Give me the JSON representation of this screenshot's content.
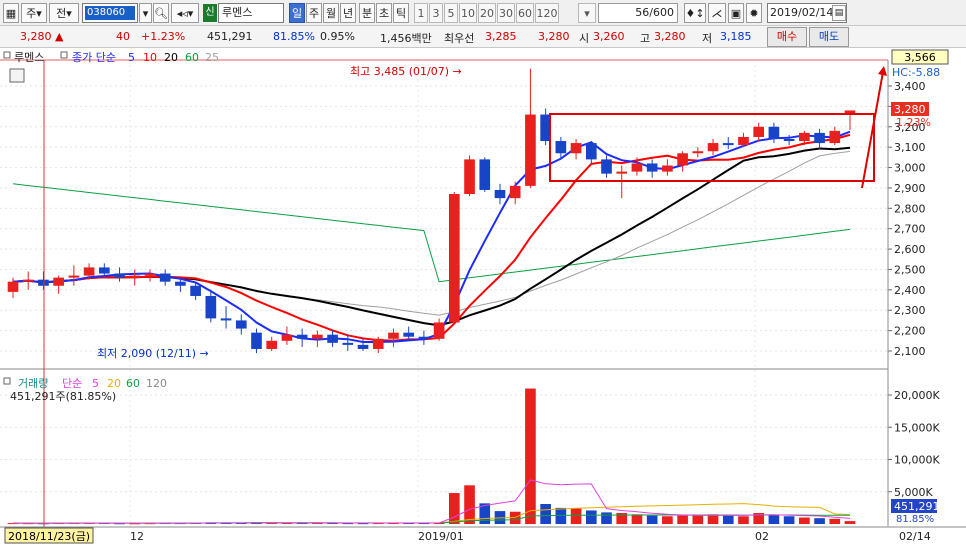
{
  "toolbar": {
    "period_1": "주",
    "period_2": "전",
    "stock_code": "038060",
    "market_tag": "신",
    "stock_name": "루멘스",
    "period_buttons": [
      "일",
      "주",
      "월",
      "년",
      "분",
      "초",
      "틱"
    ],
    "interval_buttons": [
      "1",
      "3",
      "5",
      "10",
      "20",
      "30",
      "60",
      "120"
    ],
    "count_value": "56",
    "count_total": "/600",
    "date_value": "2019/02/14"
  },
  "quote": {
    "price": "3,280",
    "direction": "▲",
    "change": "40",
    "change_pct": "+1.23%",
    "volume": "451,291",
    "volume_ratio": "81.85%",
    "turnover": "0.95%",
    "amount": "1,456백만",
    "best_bid_label": "최우선",
    "best_ask": "3,285",
    "best_bid": "3,280",
    "open_label": "시",
    "open": "3,260",
    "high_label": "고",
    "high": "3,280",
    "low_label": "저",
    "low": "3,185",
    "buy_button": "매수",
    "sell_button": "매도"
  },
  "price_panel": {
    "name": "루멘스",
    "indicator_label": "종가 단순",
    "ma_periods": [
      "5",
      "10",
      "20",
      "60",
      "25"
    ],
    "high_note": "최고 3,485 (01/07) →",
    "low_note": "최저 2,090 (12/11) →",
    "current_price_tag": "3,280",
    "current_pct_tag": "1.23%",
    "arrow_price_tag": "3,566",
    "hc_label": "HC:-5.88"
  },
  "volume_panel": {
    "title": "거래량",
    "indicator_label": "단순",
    "ma_periods": [
      "5",
      "20",
      "60",
      "120"
    ],
    "volume_note": "451,291주(81.85%)",
    "current_volume_tag": "451,291",
    "current_volume_pct": "81.85%"
  },
  "x_axis": {
    "start_label": "2018/11/23(금)",
    "tick_labels": [
      "12",
      "2019/01",
      "02"
    ],
    "end_label": "02/14"
  },
  "colors": {
    "up": "#e8201e",
    "down": "#1844c8",
    "ma5": "#1c2cff",
    "ma10": "#ff0000",
    "ma20": "#000000",
    "ma60": "#0aa040",
    "ma25": "#a0a0a0",
    "vol_ma5": "#e040e0",
    "vol_ma20": "#e8b000",
    "vol_ma60": "#10a040",
    "highlight_box": "#e00000"
  },
  "chart_data": {
    "type": "candlestick",
    "price_axis": {
      "ylim": [
        2000,
        3600
      ],
      "ticks": [
        2100,
        2200,
        2300,
        2400,
        2500,
        2600,
        2700,
        2800,
        2900,
        3000,
        3100,
        3200,
        3300,
        3400
      ],
      "tick_labels": [
        "2,100",
        "2,200",
        "2,300",
        "2,400",
        "2,500",
        "2,600",
        "2,700",
        "2,800",
        "2,900",
        "3,000",
        "3,100",
        "3,200",
        "3,300",
        "3,400"
      ]
    },
    "volume_axis": {
      "ylim": [
        0,
        21000000
      ],
      "ticks": [
        5000000,
        10000000,
        15000000,
        20000000
      ],
      "tick_labels": [
        "5,000K",
        "10,000K",
        "15,000K",
        "20,000K"
      ]
    },
    "candles": [
      {
        "o": 2390,
        "h": 2460,
        "l": 2360,
        "c": 2440
      },
      {
        "o": 2440,
        "h": 2490,
        "l": 2400,
        "c": 2450
      },
      {
        "o": 2450,
        "h": 2490,
        "l": 2400,
        "c": 2420
      },
      {
        "o": 2420,
        "h": 2470,
        "l": 2380,
        "c": 2460
      },
      {
        "o": 2460,
        "h": 2520,
        "l": 2420,
        "c": 2470
      },
      {
        "o": 2470,
        "h": 2530,
        "l": 2450,
        "c": 2510
      },
      {
        "o": 2510,
        "h": 2530,
        "l": 2460,
        "c": 2480
      },
      {
        "o": 2480,
        "h": 2510,
        "l": 2440,
        "c": 2460
      },
      {
        "o": 2460,
        "h": 2500,
        "l": 2420,
        "c": 2470
      },
      {
        "o": 2470,
        "h": 2500,
        "l": 2440,
        "c": 2480
      },
      {
        "o": 2480,
        "h": 2500,
        "l": 2420,
        "c": 2440
      },
      {
        "o": 2440,
        "h": 2460,
        "l": 2390,
        "c": 2420
      },
      {
        "o": 2420,
        "h": 2440,
        "l": 2350,
        "c": 2370
      },
      {
        "o": 2370,
        "h": 2400,
        "l": 2240,
        "c": 2260
      },
      {
        "o": 2260,
        "h": 2320,
        "l": 2210,
        "c": 2250
      },
      {
        "o": 2250,
        "h": 2280,
        "l": 2180,
        "c": 2210
      },
      {
        "o": 2190,
        "h": 2210,
        "l": 2090,
        "c": 2110
      },
      {
        "o": 2110,
        "h": 2170,
        "l": 2100,
        "c": 2150
      },
      {
        "o": 2150,
        "h": 2220,
        "l": 2130,
        "c": 2180
      },
      {
        "o": 2180,
        "h": 2210,
        "l": 2120,
        "c": 2160
      },
      {
        "o": 2160,
        "h": 2200,
        "l": 2120,
        "c": 2180
      },
      {
        "o": 2180,
        "h": 2200,
        "l": 2120,
        "c": 2140
      },
      {
        "o": 2140,
        "h": 2180,
        "l": 2100,
        "c": 2130
      },
      {
        "o": 2130,
        "h": 2160,
        "l": 2100,
        "c": 2110
      },
      {
        "o": 2110,
        "h": 2170,
        "l": 2090,
        "c": 2160
      },
      {
        "o": 2160,
        "h": 2210,
        "l": 2120,
        "c": 2190
      },
      {
        "o": 2190,
        "h": 2220,
        "l": 2150,
        "c": 2170
      },
      {
        "o": 2170,
        "h": 2200,
        "l": 2130,
        "c": 2160
      },
      {
        "o": 2160,
        "h": 2260,
        "l": 2150,
        "c": 2240
      },
      {
        "o": 2240,
        "h": 2880,
        "l": 2230,
        "c": 2870
      },
      {
        "o": 2870,
        "h": 3060,
        "l": 2860,
        "c": 3040
      },
      {
        "o": 3040,
        "h": 3050,
        "l": 2880,
        "c": 2890
      },
      {
        "o": 2890,
        "h": 2920,
        "l": 2820,
        "c": 2850
      },
      {
        "o": 2850,
        "h": 2930,
        "l": 2820,
        "c": 2910
      },
      {
        "o": 2910,
        "h": 3485,
        "l": 2900,
        "c": 3260
      },
      {
        "o": 3260,
        "h": 3290,
        "l": 3110,
        "c": 3130
      },
      {
        "o": 3130,
        "h": 3150,
        "l": 3040,
        "c": 3070
      },
      {
        "o": 3070,
        "h": 3140,
        "l": 3040,
        "c": 3120
      },
      {
        "o": 3120,
        "h": 3130,
        "l": 3020,
        "c": 3040
      },
      {
        "o": 3040,
        "h": 3060,
        "l": 2950,
        "c": 2970
      },
      {
        "o": 2970,
        "h": 3010,
        "l": 2850,
        "c": 2980
      },
      {
        "o": 2980,
        "h": 3050,
        "l": 2960,
        "c": 3020
      },
      {
        "o": 3020,
        "h": 3040,
        "l": 2950,
        "c": 2980
      },
      {
        "o": 2980,
        "h": 3040,
        "l": 2960,
        "c": 3010
      },
      {
        "o": 3010,
        "h": 3080,
        "l": 2980,
        "c": 3070
      },
      {
        "o": 3070,
        "h": 3100,
        "l": 3050,
        "c": 3080
      },
      {
        "o": 3080,
        "h": 3140,
        "l": 3060,
        "c": 3120
      },
      {
        "o": 3120,
        "h": 3150,
        "l": 3090,
        "c": 3110
      },
      {
        "o": 3110,
        "h": 3170,
        "l": 3100,
        "c": 3150
      },
      {
        "o": 3150,
        "h": 3220,
        "l": 3130,
        "c": 3200
      },
      {
        "o": 3200,
        "h": 3220,
        "l": 3120,
        "c": 3140
      },
      {
        "o": 3140,
        "h": 3160,
        "l": 3110,
        "c": 3130
      },
      {
        "o": 3130,
        "h": 3180,
        "l": 3110,
        "c": 3170
      },
      {
        "o": 3170,
        "h": 3190,
        "l": 3090,
        "c": 3120
      },
      {
        "o": 3120,
        "h": 3200,
        "l": 3110,
        "c": 3180
      },
      {
        "o": 3260,
        "h": 3280,
        "l": 3185,
        "c": 3280
      }
    ],
    "volumes": [
      140000,
      130000,
      120000,
      150000,
      160000,
      180000,
      150000,
      120000,
      110000,
      130000,
      150000,
      140000,
      160000,
      250000,
      220000,
      200000,
      260000,
      180000,
      170000,
      160000,
      170000,
      150000,
      140000,
      130000,
      150000,
      180000,
      160000,
      150000,
      170000,
      4800000,
      6000000,
      3200000,
      2000000,
      1900000,
      21000000,
      3100000,
      2500000,
      2400000,
      2100000,
      1800000,
      1700000,
      1500000,
      1300000,
      1200000,
      1300000,
      1400000,
      1500000,
      1300000,
      1200000,
      1700000,
      1400000,
      1200000,
      1000000,
      900000,
      800000,
      451291
    ]
  }
}
